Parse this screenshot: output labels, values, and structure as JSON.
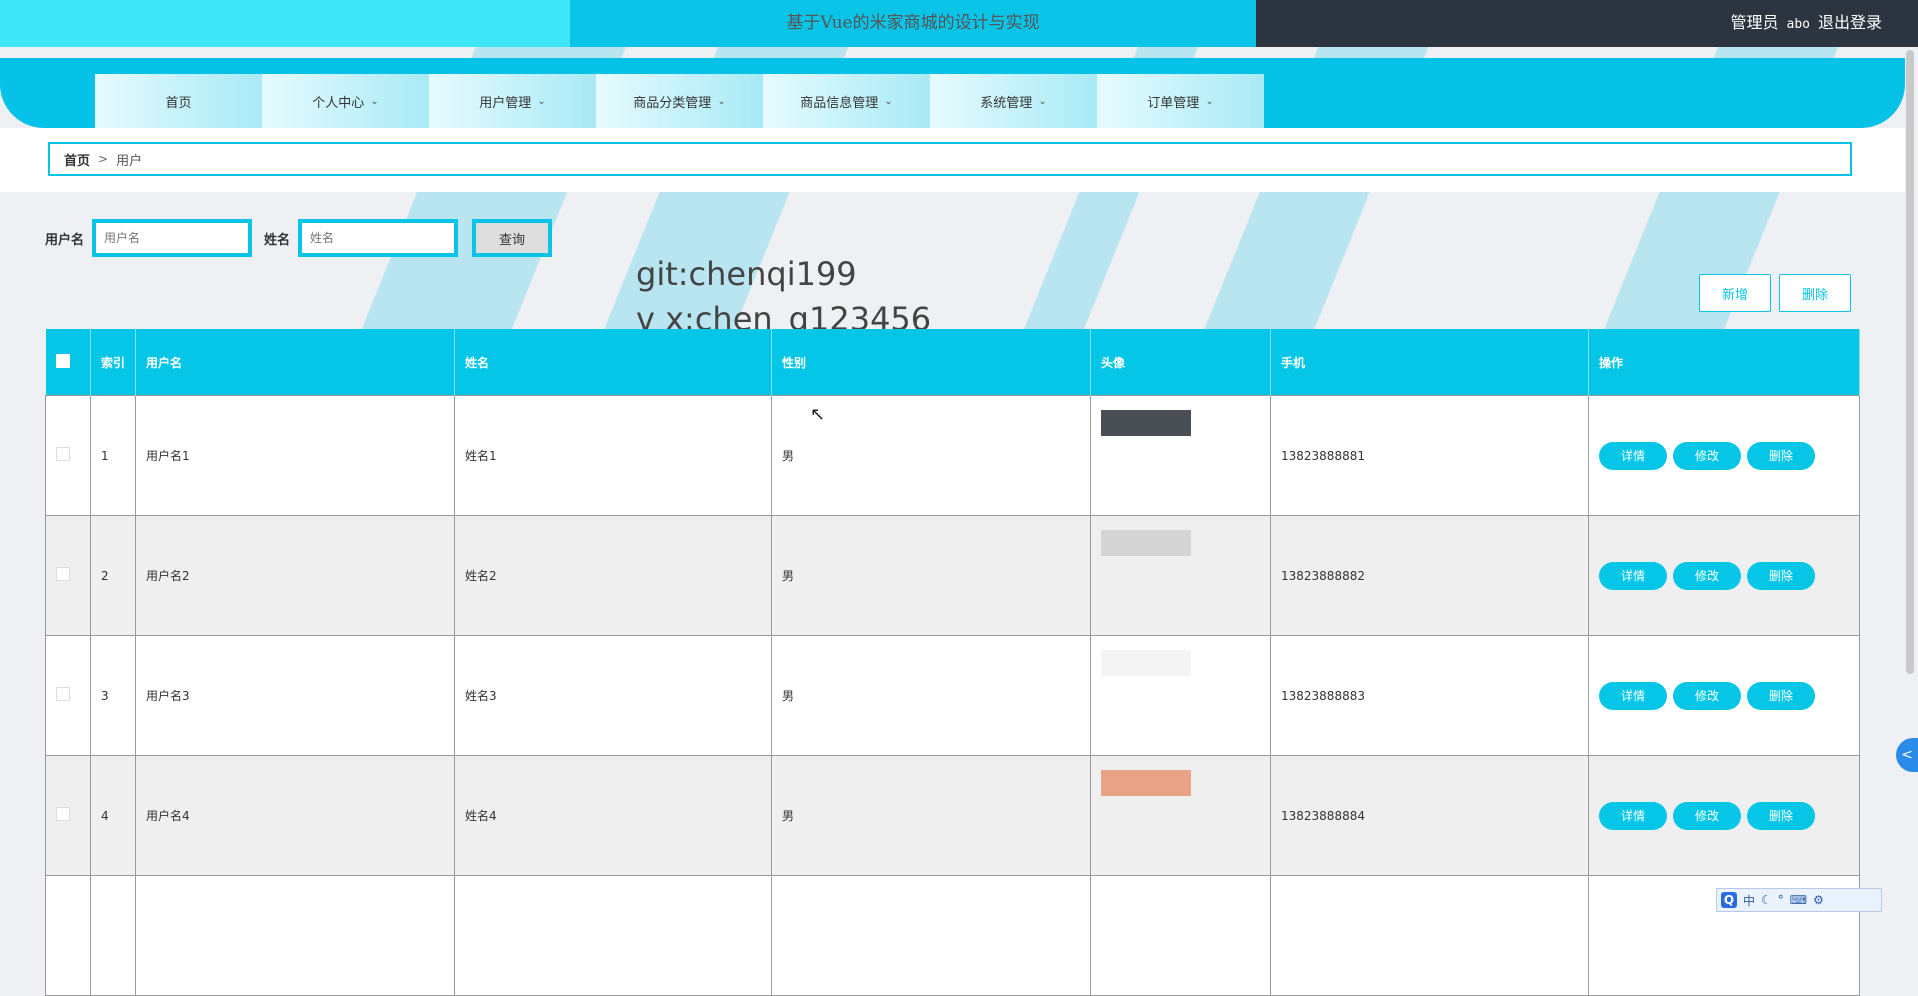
{
  "header": {
    "title": "基于Vue的米家商城的设计与实现",
    "role": "管理员",
    "username": "abo",
    "logout": "退出登录"
  },
  "nav": [
    {
      "label": "首页",
      "dropdown": false
    },
    {
      "label": "个人中心",
      "dropdown": true
    },
    {
      "label": "用户管理",
      "dropdown": true
    },
    {
      "label": "商品分类管理",
      "dropdown": true
    },
    {
      "label": "商品信息管理",
      "dropdown": true
    },
    {
      "label": "系统管理",
      "dropdown": true
    },
    {
      "label": "订单管理",
      "dropdown": true
    }
  ],
  "breadcrumb": {
    "home": "首页",
    "current": "用户"
  },
  "search": {
    "username_label": "用户名",
    "username_placeholder": "用户名",
    "name_label": "姓名",
    "name_placeholder": "姓名",
    "query_button": "查询"
  },
  "watermark": {
    "line1": "git:chenqi199",
    "line2": "v x:chen_q123456"
  },
  "toolbar": {
    "add": "新增",
    "delete": "删除"
  },
  "table": {
    "columns": [
      "索引",
      "用户名",
      "姓名",
      "性别",
      "头像",
      "手机",
      "操作"
    ],
    "rows": [
      {
        "index": "1",
        "username": "用户名1",
        "name": "姓名1",
        "gender": "男",
        "phone": "13823888881",
        "avatar_color": "#4a4e55"
      },
      {
        "index": "2",
        "username": "用户名2",
        "name": "姓名2",
        "gender": "男",
        "phone": "13823888882",
        "avatar_color": "#d5d5d5"
      },
      {
        "index": "3",
        "username": "用户名3",
        "name": "姓名3",
        "gender": "男",
        "phone": "13823888883",
        "avatar_color": "#f4f4f4"
      },
      {
        "index": "4",
        "username": "用户名4",
        "name": "姓名4",
        "gender": "男",
        "phone": "13823888884",
        "avatar_color": "#e8a286"
      }
    ],
    "actions": {
      "detail": "详情",
      "edit": "修改",
      "delete": "删除"
    }
  },
  "ime": {
    "logo": "Q",
    "lang": "中"
  }
}
